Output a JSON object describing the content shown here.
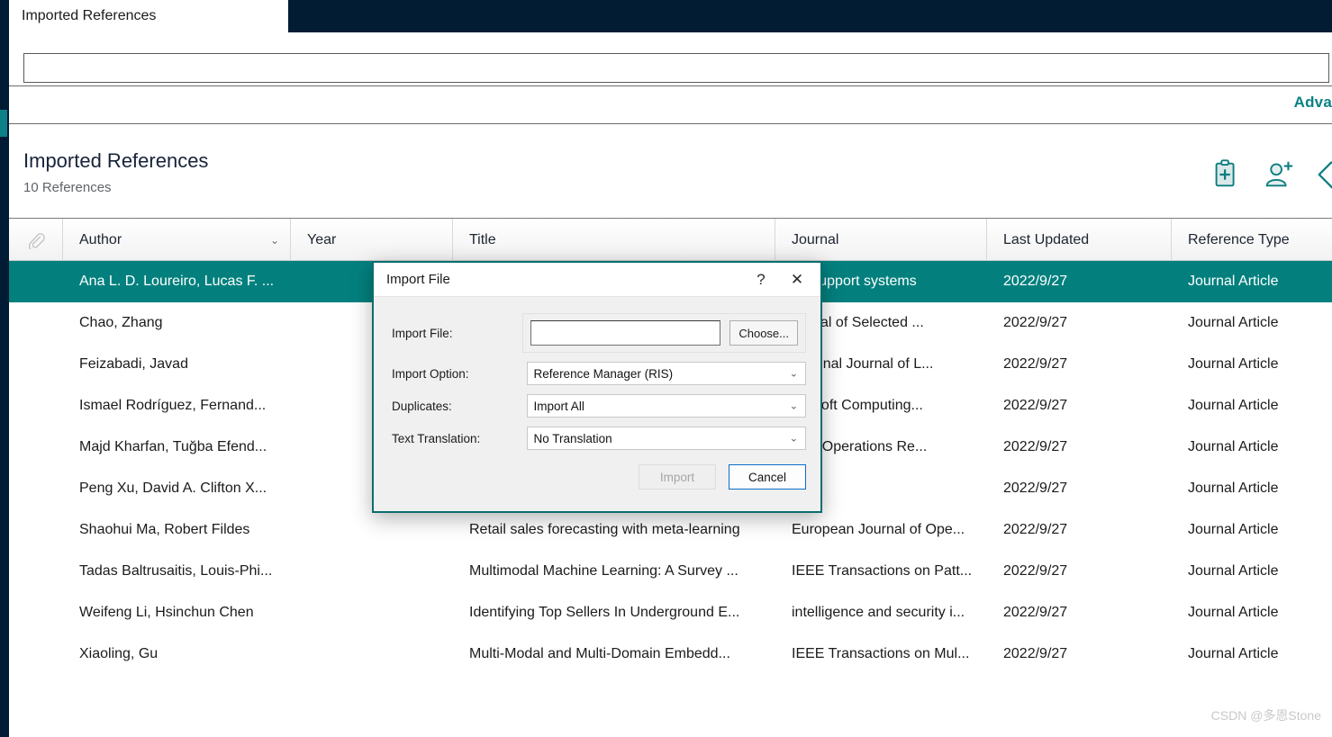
{
  "app": {
    "tab_label": "Imported References",
    "search_value": "",
    "search_placeholder": "",
    "advanced_link": "Adva",
    "watermark": "CSDN @多恩Stone"
  },
  "colors": {
    "navy": "#011c33",
    "teal": "#03807e",
    "teal_accent": "#0a8184",
    "dialog_border": "#0b6e6e"
  },
  "header": {
    "title": "Imported References",
    "subtitle": "10 References",
    "icons": [
      {
        "name": "add-to-clipboard-icon",
        "label": "clipboard-plus-icon"
      },
      {
        "name": "add-user-icon",
        "label": "person-plus-icon"
      },
      {
        "name": "share-tag-icon",
        "label": "tag-icon"
      }
    ]
  },
  "table": {
    "columns": [
      {
        "key": "attachment",
        "label": "",
        "icon": "paperclip-icon",
        "sortable": false
      },
      {
        "key": "author",
        "label": "Author",
        "sortable": true,
        "sort_indicator": "⌄"
      },
      {
        "key": "year",
        "label": "Year",
        "sortable": true
      },
      {
        "key": "title",
        "label": "Title",
        "sortable": true
      },
      {
        "key": "journal",
        "label": "Journal",
        "sortable": true
      },
      {
        "key": "last_updated",
        "label": "Last Updated",
        "sortable": true
      },
      {
        "key": "reference_type",
        "label": "Reference Type",
        "sortable": true
      }
    ],
    "rows": [
      {
        "selected": true,
        "author": "Ana L. D. Loureiro, Lucas F. ...",
        "year": "",
        "title": "",
        "journal": "on support systems",
        "last_updated": "2022/9/27",
        "reference_type": "Journal Article"
      },
      {
        "selected": false,
        "author": "Chao, Zhang",
        "year": "",
        "title": "",
        "journal": "ournal of Selected ...",
        "last_updated": "2022/9/27",
        "reference_type": "Journal Article"
      },
      {
        "selected": false,
        "author": "Feizabadi, Javad",
        "year": "",
        "title": "",
        "journal": "national Journal of L...",
        "last_updated": "2022/9/27",
        "reference_type": "Journal Article"
      },
      {
        "selected": false,
        "author": "Ismael Rodríguez, Fernand...",
        "year": "",
        "title": "",
        "journal": "ed Soft Computing...",
        "last_updated": "2022/9/27",
        "reference_type": "Journal Article"
      },
      {
        "selected": false,
        "author": "Majd Kharfan, Tuğba Efend...",
        "year": "",
        "title": "",
        "journal": "ls of Operations Re...",
        "last_updated": "2022/9/27",
        "reference_type": "Journal Article"
      },
      {
        "selected": false,
        "author": "Peng Xu, David A. Clifton X...",
        "year": "",
        "title": "",
        "journal": "",
        "last_updated": "2022/9/27",
        "reference_type": "Journal Article"
      },
      {
        "selected": false,
        "author": "Shaohui Ma, Robert Fildes",
        "year": "",
        "title": "Retail sales forecasting with meta-learning",
        "journal": "European Journal of Ope...",
        "last_updated": "2022/9/27",
        "reference_type": "Journal Article"
      },
      {
        "selected": false,
        "author": "Tadas Baltrusaitis, Louis-Phi...",
        "year": "",
        "title": "Multimodal Machine Learning: A Survey ...",
        "journal": "IEEE Transactions on Patt...",
        "last_updated": "2022/9/27",
        "reference_type": "Journal Article"
      },
      {
        "selected": false,
        "author": "Weifeng Li, Hsinchun Chen",
        "year": "",
        "title": "Identifying Top Sellers In Underground E...",
        "journal": "intelligence and security i...",
        "last_updated": "2022/9/27",
        "reference_type": "Journal Article"
      },
      {
        "selected": false,
        "author": "Xiaoling, Gu",
        "year": "",
        "title": "Multi-Modal and Multi-Domain Embedd...",
        "journal": "IEEE Transactions on Mul...",
        "last_updated": "2022/9/27",
        "reference_type": "Journal Article"
      }
    ]
  },
  "dialog": {
    "title": "Import File",
    "help_label": "?",
    "close_label": "✕",
    "fields": {
      "import_file": {
        "label": "Import File:",
        "value": "",
        "placeholder": "",
        "choose_label": "Choose..."
      },
      "import_option": {
        "label": "Import Option:",
        "value": "Reference Manager (RIS)"
      },
      "duplicates": {
        "label": "Duplicates:",
        "value": "Import All"
      },
      "text_translation": {
        "label": "Text Translation:",
        "value": "No Translation"
      }
    },
    "buttons": {
      "import": "Import",
      "cancel": "Cancel"
    }
  }
}
